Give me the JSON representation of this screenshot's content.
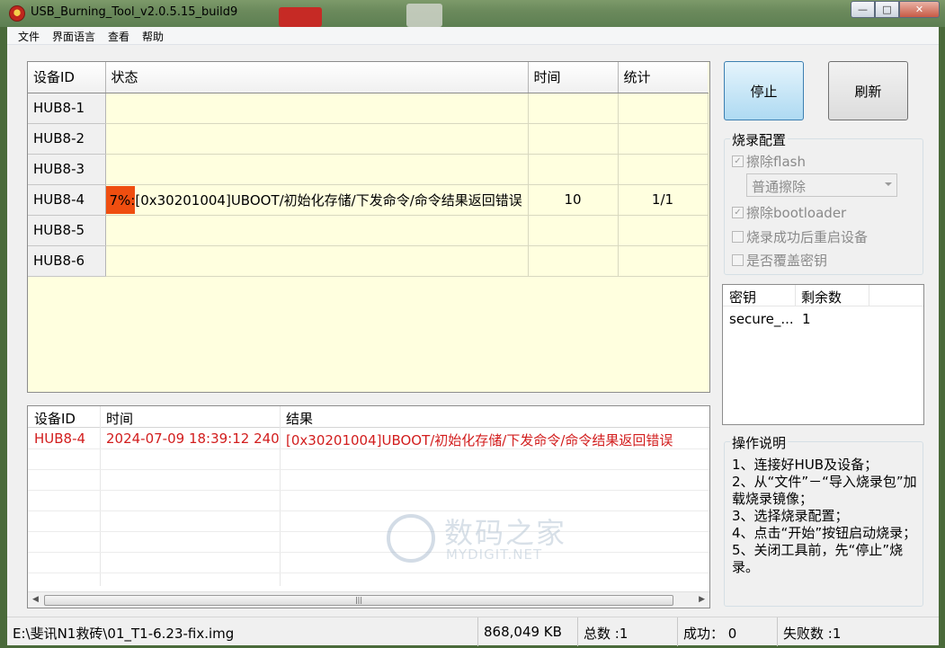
{
  "window": {
    "title": "USB_Burning_Tool_v2.0.5.15_build9",
    "min_icon": "minimize-icon",
    "max_icon": "maximize-icon",
    "close_icon": "close-icon"
  },
  "menu": [
    "文件",
    "界面语言",
    "查看",
    "帮助"
  ],
  "devices": {
    "headers": [
      "设备ID",
      "状态",
      "时间",
      "统计"
    ],
    "rows": [
      {
        "id": "HUB8-1",
        "progress": "",
        "status": "",
        "time": "",
        "stats": ""
      },
      {
        "id": "HUB8-2",
        "progress": "",
        "status": "",
        "time": "",
        "stats": ""
      },
      {
        "id": "HUB8-3",
        "progress": "",
        "status": "",
        "time": "",
        "stats": ""
      },
      {
        "id": "HUB8-4",
        "progress": "7%",
        "status": ":[0x30201004]UBOOT/初始化存储/下发命令/命令结果返回错误",
        "time": "10",
        "stats": "1/1",
        "progress_fraction": 0.07
      },
      {
        "id": "HUB8-5",
        "progress": "",
        "status": "",
        "time": "",
        "stats": ""
      },
      {
        "id": "HUB8-6",
        "progress": "",
        "status": "",
        "time": "",
        "stats": ""
      }
    ],
    "grid_color": "#ffffdf",
    "progress_color": "#ef4e10"
  },
  "buttons": {
    "stop": "停止",
    "refresh": "刷新"
  },
  "config": {
    "title": "烧录配置",
    "erase_flash": {
      "label": "擦除flash",
      "checked": true,
      "disabled": true
    },
    "erase_mode": "普通擦除",
    "erase_bootloader": {
      "label": "擦除bootloader",
      "checked": true,
      "disabled": true
    },
    "reboot_after": {
      "label": "烧录成功后重启设备",
      "checked": false,
      "disabled": true
    },
    "overwrite_key": {
      "label": "是否覆盖密钥",
      "checked": false,
      "disabled": true
    }
  },
  "keys": {
    "headers": [
      "密钥",
      "剩余数"
    ],
    "rows": [
      {
        "name": "secure_...",
        "remaining": "1"
      }
    ]
  },
  "instructions": {
    "title": "操作说明",
    "text": "1、连接好HUB及设备；\n2、从“文件”－“导入烧录包”加载烧录镜像；\n3、选择烧录配置；\n4、点击“开始”按钮启动烧录；\n5、关闭工具前，先“停止”烧录。"
  },
  "log": {
    "headers": [
      "设备ID",
      "时间",
      "结果"
    ],
    "rows": [
      {
        "id": "HUB8-4",
        "time": "2024-07-09 18:39:12 240",
        "result": "[0x30201004]UBOOT/初始化存储/下发命令/命令结果返回错误"
      }
    ],
    "row_color": "#d21d1d"
  },
  "watermark": {
    "cn": "数码之家",
    "en": "MYDIGIT.NET"
  },
  "statusbar": {
    "path": "E:\\斐讯N1救砖\\01_T1-6.23-fix.img",
    "size": "868,049 KB",
    "total": "总数 :1",
    "success": "成功： 0",
    "failed": "失败数 :1"
  }
}
